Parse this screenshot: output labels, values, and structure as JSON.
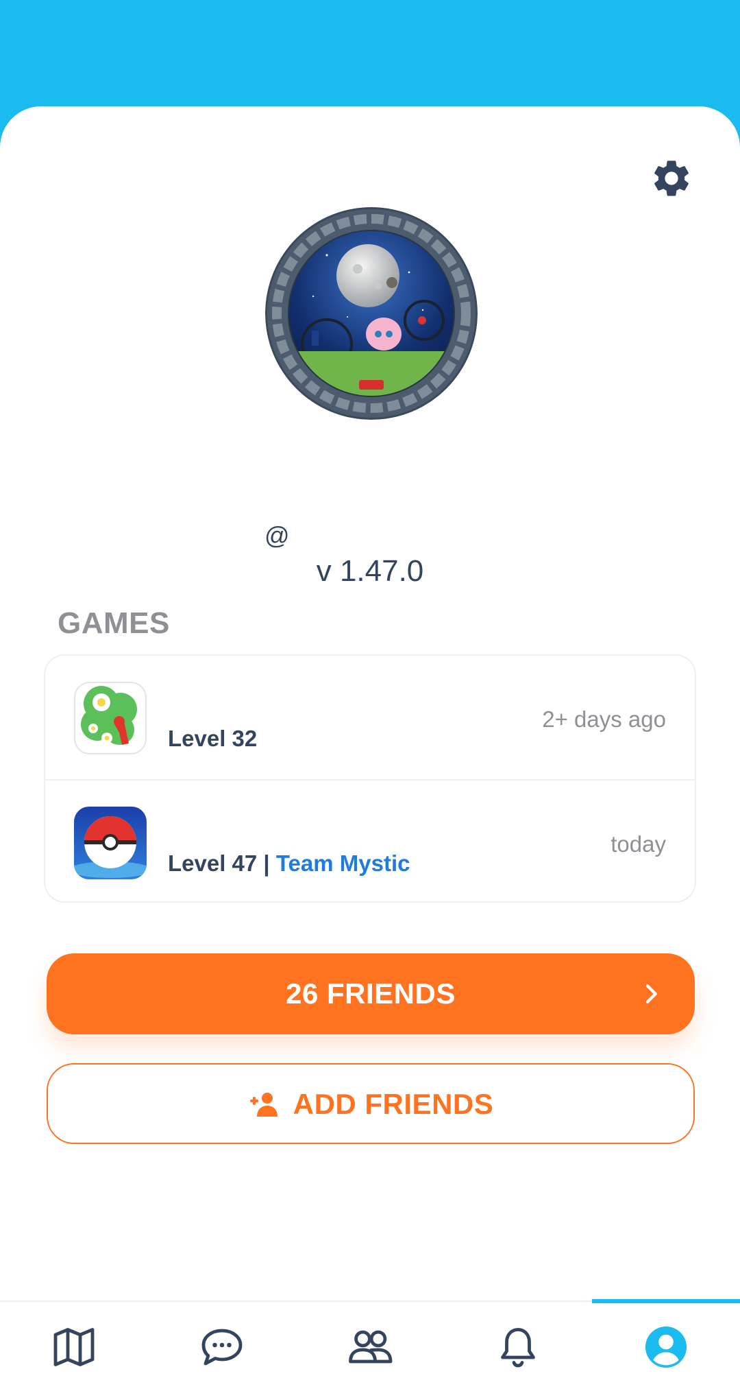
{
  "profile": {
    "at_symbol": "@",
    "version": "v 1.47.0"
  },
  "games": {
    "heading": "GAMES",
    "items": [
      {
        "icon": "pikmin-bloom-icon",
        "level": "Level 32",
        "team_separator": "",
        "team": "",
        "last_played": "2+ days ago"
      },
      {
        "icon": "pokemon-go-icon",
        "level": "Level 47",
        "team_separator": " | ",
        "team": "Team Mystic",
        "last_played": "today"
      }
    ]
  },
  "friends_button": {
    "label": "26 FRIENDS",
    "icon": "chevron-right-icon"
  },
  "add_friends_button": {
    "label": "ADD FRIENDS",
    "icon": "add-person-icon"
  },
  "nav": {
    "items": [
      {
        "name": "map",
        "icon": "map-icon"
      },
      {
        "name": "chat",
        "icon": "chat-bubble-icon"
      },
      {
        "name": "people",
        "icon": "people-icon"
      },
      {
        "name": "notifications",
        "icon": "bell-icon"
      },
      {
        "name": "profile",
        "icon": "profile-icon",
        "active": true
      }
    ]
  },
  "colors": {
    "accent_blue": "#1ABBEF",
    "orange": "#FF7320",
    "team_blue": "#1E7CE0",
    "text_dark": "#34445E",
    "text_gray": "#8E9095"
  }
}
